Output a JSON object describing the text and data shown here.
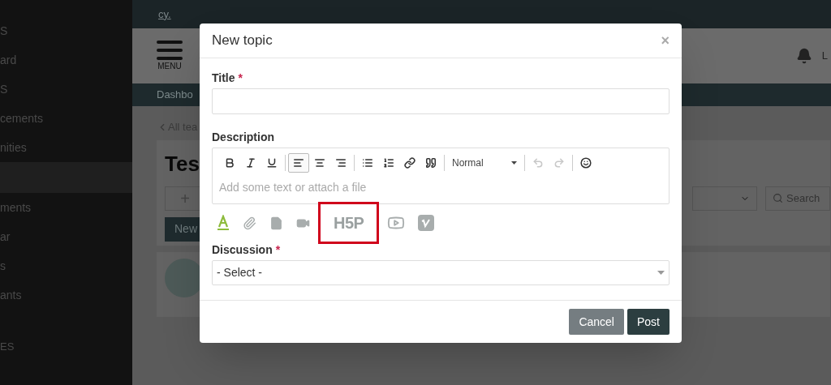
{
  "background": {
    "top_bar": {
      "text": "cy."
    },
    "sidebar": {
      "items": [
        {
          "label": "S",
          "selected": false
        },
        {
          "label": "ard",
          "selected": false
        },
        {
          "label": "S",
          "selected": false
        },
        {
          "label": "cements",
          "selected": false
        },
        {
          "label": "nities",
          "selected": false
        },
        {
          "selected": true
        },
        {
          "label": "ments",
          "selected": false
        },
        {
          "label": "ar",
          "selected": false
        },
        {
          "label": "s",
          "selected": false
        },
        {
          "label": "ants",
          "selected": false
        }
      ],
      "section": "ES"
    },
    "header": {
      "menu_label": "MENU",
      "user": "L"
    },
    "nav": {
      "item": "Dashbo"
    },
    "back_link": "All tea",
    "page_title": "Tes",
    "add_label": "+",
    "new_button": "New",
    "search_placeholder": "Search"
  },
  "dialog": {
    "title": "New topic",
    "close": "×",
    "required_mark": "*",
    "fields": [
      {
        "kind": "text",
        "label": "Title",
        "required": true
      },
      {
        "kind": "editor",
        "label": "Description",
        "required": false,
        "placeholder": "Add some text or attach a file",
        "toolbar": [
          {
            "kind": "button",
            "selected": false,
            "disabled": false
          },
          {
            "kind": "button",
            "selected": false,
            "disabled": false
          },
          {
            "kind": "button",
            "selected": false,
            "disabled": false
          },
          {
            "kind": "divider"
          },
          {
            "kind": "button",
            "selected": true,
            "disabled": false
          },
          {
            "kind": "button",
            "selected": false,
            "disabled": false
          },
          {
            "kind": "button",
            "selected": false,
            "disabled": false
          },
          {
            "kind": "divider"
          },
          {
            "kind": "button",
            "selected": false,
            "disabled": false
          },
          {
            "kind": "button",
            "selected": false,
            "disabled": false
          },
          {
            "kind": "button",
            "selected": false,
            "disabled": false
          },
          {
            "kind": "button",
            "selected": false,
            "disabled": false
          },
          {
            "kind": "divider"
          },
          {
            "kind": "select",
            "value": "Normal"
          },
          {
            "kind": "divider"
          },
          {
            "kind": "button",
            "selected": false,
            "disabled": true
          },
          {
            "kind": "button",
            "selected": false,
            "disabled": true
          },
          {
            "kind": "divider"
          },
          {
            "kind": "button",
            "selected": false,
            "disabled": false
          }
        ],
        "attachments": [
          {
            "kind": "icon",
            "highlighted": false
          },
          {
            "kind": "icon",
            "highlighted": false
          },
          {
            "kind": "icon",
            "highlighted": false
          },
          {
            "kind": "icon",
            "highlighted": false
          },
          {
            "kind": "logo",
            "text": "H5P",
            "highlighted": true
          },
          {
            "kind": "icon",
            "highlighted": false
          },
          {
            "kind": "icon",
            "highlighted": false
          }
        ]
      },
      {
        "kind": "select",
        "label": "Discussion",
        "required": true,
        "value": "- Select -"
      }
    ],
    "buttons": [
      {
        "label": "Cancel",
        "kind": "secondary"
      },
      {
        "label": "Post",
        "kind": "primary"
      }
    ]
  }
}
